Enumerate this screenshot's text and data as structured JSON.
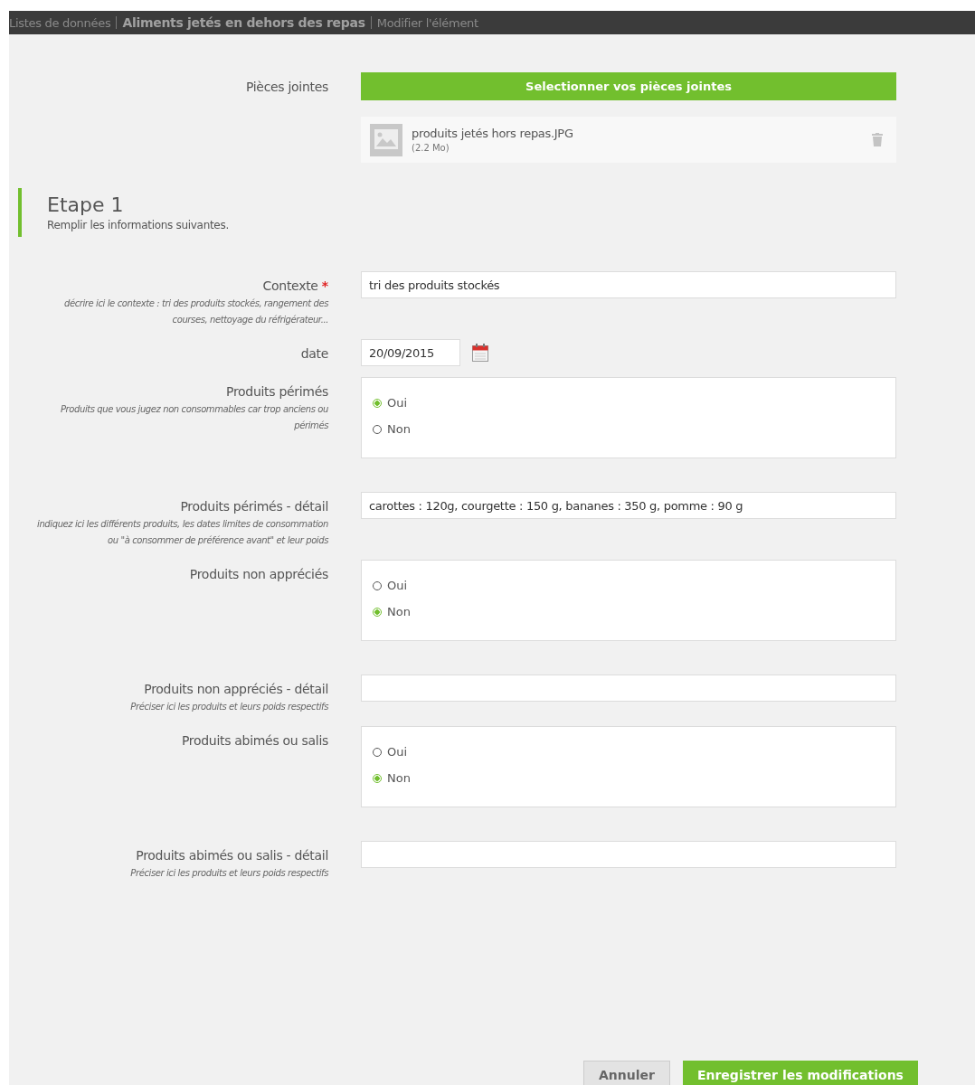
{
  "breadcrumb": [
    {
      "text": "Listes de données",
      "kind": "link"
    },
    {
      "text": "Aliments jetés en dehors des repas",
      "kind": "current"
    },
    {
      "text": "Modifier l'élément",
      "kind": "link"
    }
  ],
  "attachments": {
    "label": "Pièces jointes",
    "button": "Selectionner vos pièces jointes",
    "files": [
      {
        "name": "produits jetés hors repas.JPG",
        "size": "(2.2 Mo)"
      }
    ]
  },
  "step": {
    "title": "Etape 1",
    "subtitle": "Remplir les informations suivantes."
  },
  "fields": [
    {
      "kind": "text",
      "label": "Contexte",
      "required_mark": "*",
      "hint": "décrire ici le contexte : tri des produits stockés, rangement des courses, nettoyage du réfrigérateur...",
      "value": "tri des produits stockés"
    },
    {
      "kind": "date",
      "label": "date",
      "value": "20/09/2015"
    },
    {
      "kind": "radio",
      "label": "Produits périmés",
      "hint": "Produits que vous jugez non consommables car trop anciens ou périmés",
      "options": [
        {
          "label": "Oui",
          "selected": true
        },
        {
          "label": "Non",
          "selected": false
        }
      ]
    },
    {
      "kind": "text",
      "label": "Produits périmés - détail",
      "hint": "indiquez ici les différents produits, les dates limites de consommation ou \"à consommer de préférence avant\" et leur poids",
      "value": "carottes : 120g, courgette : 150 g, bananes : 350 g, pomme : 90 g"
    },
    {
      "kind": "radio",
      "label": "Produits non appréciés",
      "options": [
        {
          "label": "Oui",
          "selected": false
        },
        {
          "label": "Non",
          "selected": true
        }
      ]
    },
    {
      "kind": "text",
      "label": "Produits non appréciés - détail",
      "hint": "Préciser ici les produits et leurs poids respectifs"
    },
    {
      "kind": "radio",
      "label": "Produits abimés ou salis",
      "options": [
        {
          "label": "Oui",
          "selected": false
        },
        {
          "label": "Non",
          "selected": true
        }
      ]
    },
    {
      "kind": "text",
      "label": "Produits abimés ou salis - détail",
      "hint": "Préciser ici les produits et leurs poids respectifs"
    }
  ],
  "buttons": [
    {
      "label": "Annuler",
      "kind": "secondary"
    },
    {
      "label": "Enregistrer les modifications",
      "kind": "primary"
    }
  ]
}
